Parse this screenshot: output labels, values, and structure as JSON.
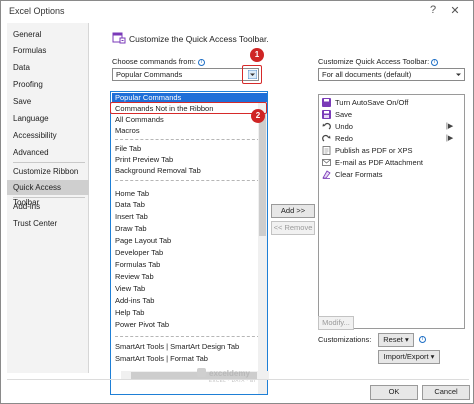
{
  "window": {
    "title": "Excel Options",
    "help_glyph": "?",
    "close_glyph": "✕"
  },
  "nav": {
    "items": [
      "General",
      "Formulas",
      "Data",
      "Proofing",
      "Save",
      "Language",
      "Accessibility",
      "Advanced",
      "Customize Ribbon",
      "Quick Access Toolbar",
      "Add-ins",
      "Trust Center"
    ],
    "selected": "Quick Access Toolbar"
  },
  "header": {
    "title": "Customize the Quick Access Toolbar."
  },
  "commands": {
    "label": "Choose commands from:",
    "selected": "Popular Commands",
    "options": [
      "Popular Commands",
      "Commands Not in the Ribbon",
      "All Commands",
      "Macros",
      "File Tab",
      "Print Preview Tab",
      "Background Removal Tab",
      "Home Tab",
      "Data Tab",
      "Insert Tab",
      "Draw Tab",
      "Page Layout Tab",
      "Developer Tab",
      "Formulas Tab",
      "Review Tab",
      "View Tab",
      "Add-ins Tab",
      "Help Tab",
      "Power Pivot Tab",
      "SmartArt Tools | SmartArt Design Tab",
      "SmartArt Tools | Format Tab"
    ]
  },
  "qat": {
    "label": "Customize Quick Access Toolbar:",
    "selected": "For all documents (default)",
    "items": [
      {
        "label": "Turn AutoSave On/Off",
        "icon": "autosave-icon",
        "color": "#7a3ab8"
      },
      {
        "label": "Save",
        "icon": "save-icon",
        "color": "#7a3ab8"
      },
      {
        "label": "Undo",
        "icon": "undo-icon",
        "color": "#444444",
        "expand": "|▶"
      },
      {
        "label": "Redo",
        "icon": "redo-icon",
        "color": "#444444",
        "expand": "|▶"
      },
      {
        "label": "Publish as PDF or XPS",
        "icon": "publish-pdf-icon",
        "color": "#666666"
      },
      {
        "label": "E-mail as PDF Attachment",
        "icon": "email-pdf-icon",
        "color": "#666666"
      },
      {
        "label": "Clear Formats",
        "icon": "clear-formats-icon",
        "color": "#7a3ab8"
      }
    ]
  },
  "buttons": {
    "add": "Add >>",
    "remove": "<< Remove",
    "modify": "Modify...",
    "reset": "Reset ▾",
    "import_export": "Import/Export ▾",
    "ok": "OK",
    "cancel": "Cancel"
  },
  "customizations_label": "Customizations:",
  "callouts": [
    "1",
    "2"
  ],
  "watermark": "exceldemy",
  "watermark_sub": "EXCEL · DATA · BI",
  "colors": {
    "highlight": "#1f6fd8",
    "callout": "#cf2525",
    "nav_selected": "#cfcfcf"
  }
}
